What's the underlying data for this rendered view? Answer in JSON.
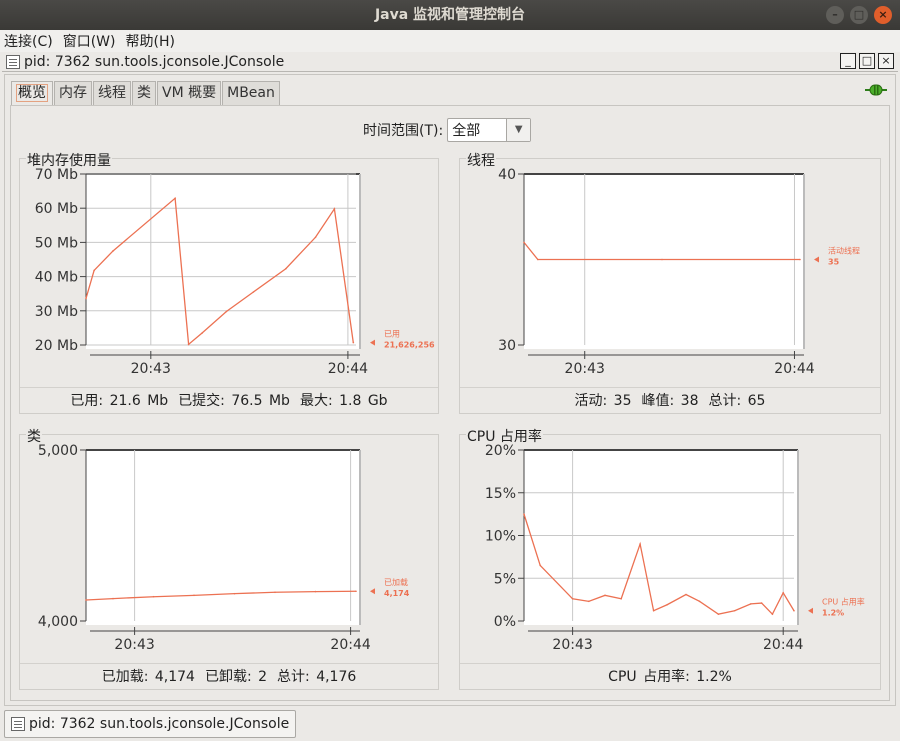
{
  "window": {
    "title": "Java 监视和管理控制台",
    "btn_min": "–",
    "btn_max": "□",
    "btn_close": "×"
  },
  "menu": [
    "连接(C)",
    "窗口(W)",
    "帮助(H)"
  ],
  "internal_frame": {
    "title": "pid: 7362 sun.tools.jconsole.JConsole",
    "btn_min": "_",
    "btn_max": "□",
    "btn_close": "×"
  },
  "tabs": [
    "概览",
    "内存",
    "线程",
    "类",
    "VM 概要",
    "MBean"
  ],
  "active_tab": "概览",
  "time_range": {
    "label": "时间范围(T):",
    "value": "全部",
    "arrow": "▼"
  },
  "colors": {
    "series": "#ec7152",
    "grid": "#c8c8c8",
    "axis": "#444444"
  },
  "panels": {
    "heap": {
      "title": "堆内存使用量",
      "legend_name": "已用",
      "legend_value": "21,626,256",
      "footer": [
        "已用: 21.6 Mb",
        "已提交: 76.5 Mb",
        "最大: 1.8 Gb"
      ]
    },
    "threads": {
      "title": "线程",
      "legend_name": "活动线程",
      "legend_value": "35",
      "footer": [
        "活动: 35",
        "峰值: 38",
        "总计: 65"
      ]
    },
    "classes": {
      "title": "类",
      "legend_name": "已加载",
      "legend_value": "4,174",
      "footer": [
        "已加载: 4,174",
        "已卸载: 2",
        "总计: 4,176"
      ]
    },
    "cpu": {
      "title": "CPU 占用率",
      "legend_name": "CPU 占用率",
      "legend_value": "1.2%",
      "footer": [
        "CPU 占用率: 1.2%"
      ]
    }
  },
  "chart_data": [
    {
      "type": "line",
      "ylabel": "",
      "x_ticks": [
        "20:43",
        "20:44"
      ],
      "y_ticks": [
        "20 Mb",
        "30 Mb",
        "40 Mb",
        "50 Mb",
        "60 Mb",
        "70 Mb"
      ],
      "ylim": [
        20,
        70
      ],
      "x": [
        0,
        0.03,
        0.1,
        0.33,
        0.38,
        0.43,
        0.52,
        0.62,
        0.74,
        0.85,
        0.92,
        0.99
      ],
      "series": [
        {
          "name": "已用",
          "values": [
            33.6,
            41.8,
            47.5,
            62.9,
            20.2,
            23.5,
            29.8,
            35.5,
            42.3,
            51.5,
            59.8,
            20.7
          ]
        }
      ]
    },
    {
      "type": "line",
      "x_ticks": [
        "20:43",
        "20:44"
      ],
      "y_ticks": [
        "30",
        "40"
      ],
      "ylim": [
        30,
        40
      ],
      "x": [
        0,
        0.05,
        0.5,
        1.0
      ],
      "series": [
        {
          "name": "活动线程",
          "values": [
            36,
            35,
            35,
            35
          ]
        }
      ]
    },
    {
      "type": "line",
      "x_ticks": [
        "20:43",
        "20:44"
      ],
      "y_ticks": [
        "4,000",
        "5,000"
      ],
      "ylim": [
        4000,
        5000
      ],
      "x": [
        0,
        0.1,
        0.25,
        0.4,
        0.55,
        0.7,
        0.85,
        1.0
      ],
      "series": [
        {
          "name": "已加载",
          "values": [
            4123,
            4131,
            4142,
            4150,
            4160,
            4168,
            4172,
            4174
          ]
        }
      ]
    },
    {
      "type": "line",
      "x_ticks": [
        "20:43",
        "20:44"
      ],
      "y_ticks": [
        "0%",
        "5%",
        "10%",
        "15%",
        "20%"
      ],
      "ylim": [
        0,
        20
      ],
      "x": [
        0,
        0.06,
        0.18,
        0.24,
        0.3,
        0.36,
        0.43,
        0.48,
        0.53,
        0.6,
        0.65,
        0.72,
        0.78,
        0.84,
        0.88,
        0.92,
        0.96,
        1.0
      ],
      "series": [
        {
          "name": "CPU 占用率",
          "values": [
            12.5,
            6.5,
            2.6,
            2.3,
            3.0,
            2.6,
            9.0,
            1.2,
            1.9,
            3.1,
            2.3,
            0.8,
            1.2,
            2.0,
            2.1,
            0.8,
            3.3,
            1.2
          ]
        }
      ]
    }
  ],
  "status": {
    "title": "pid: 7362 sun.tools.jconsole.JConsole"
  }
}
